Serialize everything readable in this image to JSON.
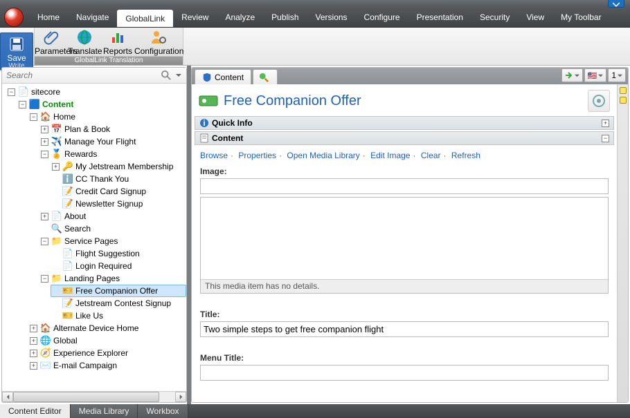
{
  "menus": [
    "Home",
    "Navigate",
    "GlobalLink",
    "Review",
    "Analyze",
    "Publish",
    "Versions",
    "Configure",
    "Presentation",
    "Security",
    "View",
    "My Toolbar"
  ],
  "active_menu": "GlobalLink",
  "ribbon": {
    "save_label": "Save",
    "save_caption": "Write",
    "globallink_caption": "GlobalLink Translation",
    "buttons": [
      "Parameters",
      "Translate",
      "Reports",
      "Configuration"
    ]
  },
  "search_placeholder": "Search",
  "tree": {
    "root": "sitecore",
    "content": "Content",
    "home": "Home",
    "plan_book": "Plan & Book",
    "manage_flight": "Manage Your Flight",
    "rewards": "Rewards",
    "my_membership": "My Jetstream Membership",
    "cc_thank_you": "CC Thank You",
    "cc_signup": "Credit Card Signup",
    "newsletter": "Newsletter Signup",
    "about": "About",
    "search": "Search",
    "service_pages": "Service Pages",
    "flight_suggestion": "Flight Suggestion",
    "login_required": "Login Required",
    "landing_pages": "Landing Pages",
    "free_companion": "Free Companion Offer",
    "contest": "Jetstream Contest Signup",
    "like_us": "Like Us",
    "alt_device": "Alternate Device Home",
    "global": "Global",
    "exp_explorer": "Experience Explorer",
    "email_campaign": "E-mail Campaign"
  },
  "content_tab": "Content",
  "version_label": "1",
  "page": {
    "title": "Free Companion Offer",
    "quick_info": "Quick Info",
    "content_section": "Content",
    "links": [
      "Browse",
      "Properties",
      "Open Media Library",
      "Edit Image",
      "Clear",
      "Refresh"
    ],
    "image_label": "Image:",
    "media_msg": "This media item has no details.",
    "title_label": "Title:",
    "title_value": "Two simple steps to get free companion flight",
    "menu_title_label": "Menu Title:"
  },
  "bottom_tabs": [
    "Content Editor",
    "Media Library",
    "Workbox"
  ],
  "active_bottom": "Content Editor"
}
